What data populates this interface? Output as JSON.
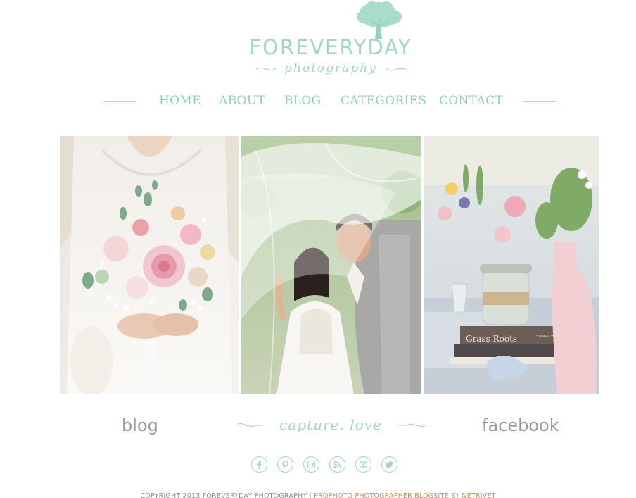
{
  "logo": {
    "word": "FOREVERYDAY",
    "sub": "photography"
  },
  "nav": {
    "items": [
      {
        "label": "HOME"
      },
      {
        "label": "ABOUT"
      },
      {
        "label": "BLOG"
      },
      {
        "label": "CATEGORIES"
      },
      {
        "label": "CONTACT"
      }
    ]
  },
  "gallery": {
    "photos": [
      {
        "subject": "bride-bouquet"
      },
      {
        "subject": "couple-under-veil"
      },
      {
        "subject": "table-flowers",
        "book_title": "Grass Roots",
        "book_author": "STUART WOODS"
      }
    ]
  },
  "footer": {
    "blog_label": "blog",
    "tagline": "capture. love",
    "facebook_label": "facebook"
  },
  "social": [
    {
      "icon": "facebook-icon"
    },
    {
      "icon": "pinterest-icon"
    },
    {
      "icon": "instagram-icon"
    },
    {
      "icon": "rss-icon"
    },
    {
      "icon": "email-icon"
    },
    {
      "icon": "twitter-icon"
    }
  ],
  "copyright": {
    "text": "COPYRIGHT 2013 FOREVERYDAY PHOTOGRAPHY",
    "separator": " | ",
    "link": "PROPHOTO PHOTOGRAPHER BLOGSITE",
    "by": " BY ",
    "link2": "NETRIVET"
  },
  "colors": {
    "accent": "#9fd6c5",
    "text_gray": "#9a9a9a",
    "link": "#c98a5a"
  }
}
